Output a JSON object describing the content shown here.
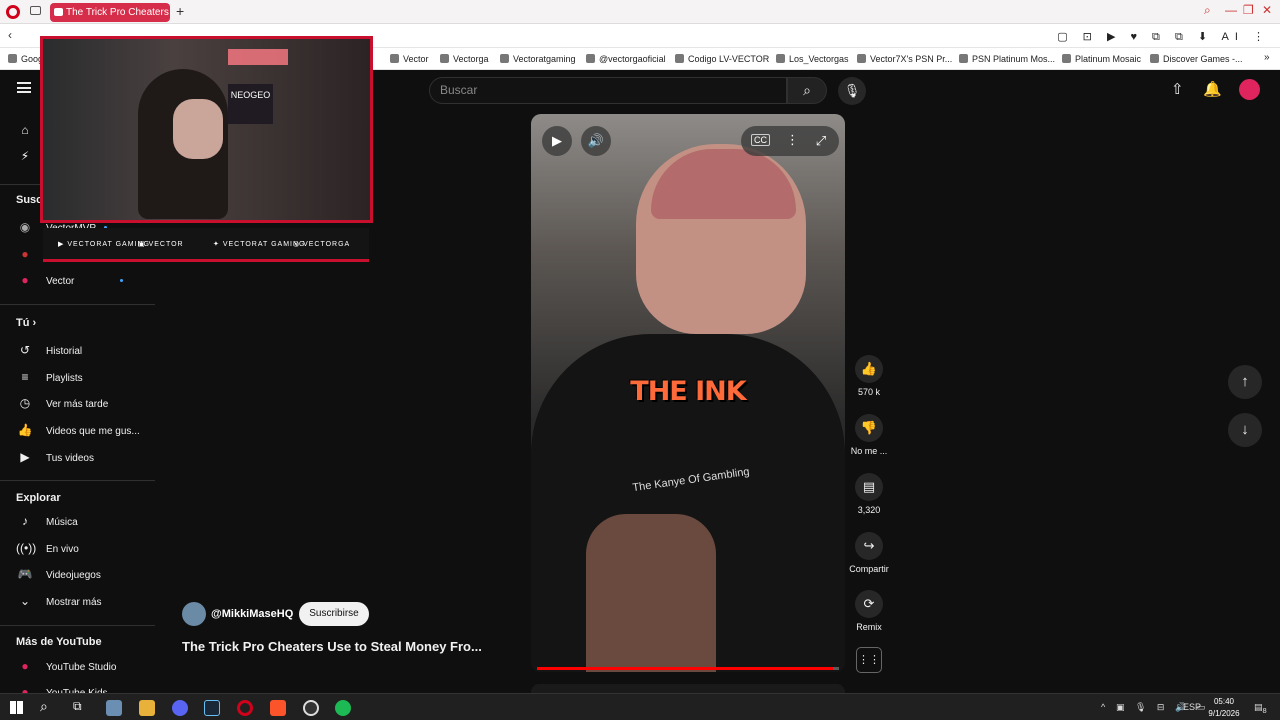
{
  "browser": {
    "tab_title": "The Trick Pro Cheaters Us",
    "new_tab": "+",
    "bookmarks": [
      {
        "label": "Goog"
      },
      {
        "label": "Vector"
      },
      {
        "label": "Vectorga"
      },
      {
        "label": "Vectoratgaming"
      },
      {
        "label": "@vectorgaoficial"
      },
      {
        "label": "Codigo LV-VECTOR"
      },
      {
        "label": "Los_Vectorgas"
      },
      {
        "label": "Vector7X's PSN Pr..."
      },
      {
        "label": "PSN Platinum Mos..."
      },
      {
        "label": "Platinum Mosaic"
      },
      {
        "label": "Discover Games -..."
      }
    ],
    "toolbar_ai": "AI"
  },
  "header": {
    "search_placeholder": "Buscar"
  },
  "sidebar": {
    "subs_heading": "Susc",
    "subscriptions": [
      {
        "label": "VectorMVP"
      },
      {
        "label": ""
      },
      {
        "label": "Vector"
      }
    ],
    "you_heading": "Tú",
    "you_items": [
      {
        "label": "Historial",
        "icon": "history-icon"
      },
      {
        "label": "Playlists",
        "icon": "playlist-icon"
      },
      {
        "label": "Ver más tarde",
        "icon": "clock-icon"
      },
      {
        "label": "Videos que me gus...",
        "icon": "thumbs-up-icon"
      },
      {
        "label": "Tus videos",
        "icon": "play-square-icon"
      }
    ],
    "explore_heading": "Explorar",
    "explore_items": [
      {
        "label": "Música",
        "icon": "music-note-icon"
      },
      {
        "label": "En vivo",
        "icon": "live-icon"
      },
      {
        "label": "Videojuegos",
        "icon": "gamepad-icon"
      },
      {
        "label": "Mostrar más",
        "icon": "chevron-down-icon"
      }
    ],
    "more_heading": "Más de YouTube",
    "more_items": [
      {
        "label": "YouTube Studio"
      },
      {
        "label": "YouTube Kids"
      }
    ]
  },
  "stream_overlay": {
    "socials": [
      "VECTORAT GAMING",
      "VECTOR",
      "VECTORAT GAMING",
      "VECTORGA"
    ],
    "arcade_sign": "NEOGEO"
  },
  "short": {
    "caption": "THE INK",
    "hoodie_text": "The Kanye Of Gambling",
    "progress": 0.98,
    "channel": "@MikkiMaseHQ",
    "subscribe_label": "Suscribirse",
    "title": "The Trick Pro Cheaters Use to Steal Money Fro...",
    "actions": {
      "likes": "570 k",
      "dislike": "No me ...",
      "comments": "3,320",
      "share": "Compartir",
      "remix": "Remix"
    }
  },
  "taskbar": {
    "language": "ESP",
    "time": "05:40",
    "date": "9/1/2026",
    "notifications": "8"
  },
  "colors": {
    "accent_red": "#c8102e",
    "youtube_bg": "#0f0f0f",
    "tab_red": "#d62d4a",
    "subscribed_dot": "#3ea6ff"
  }
}
